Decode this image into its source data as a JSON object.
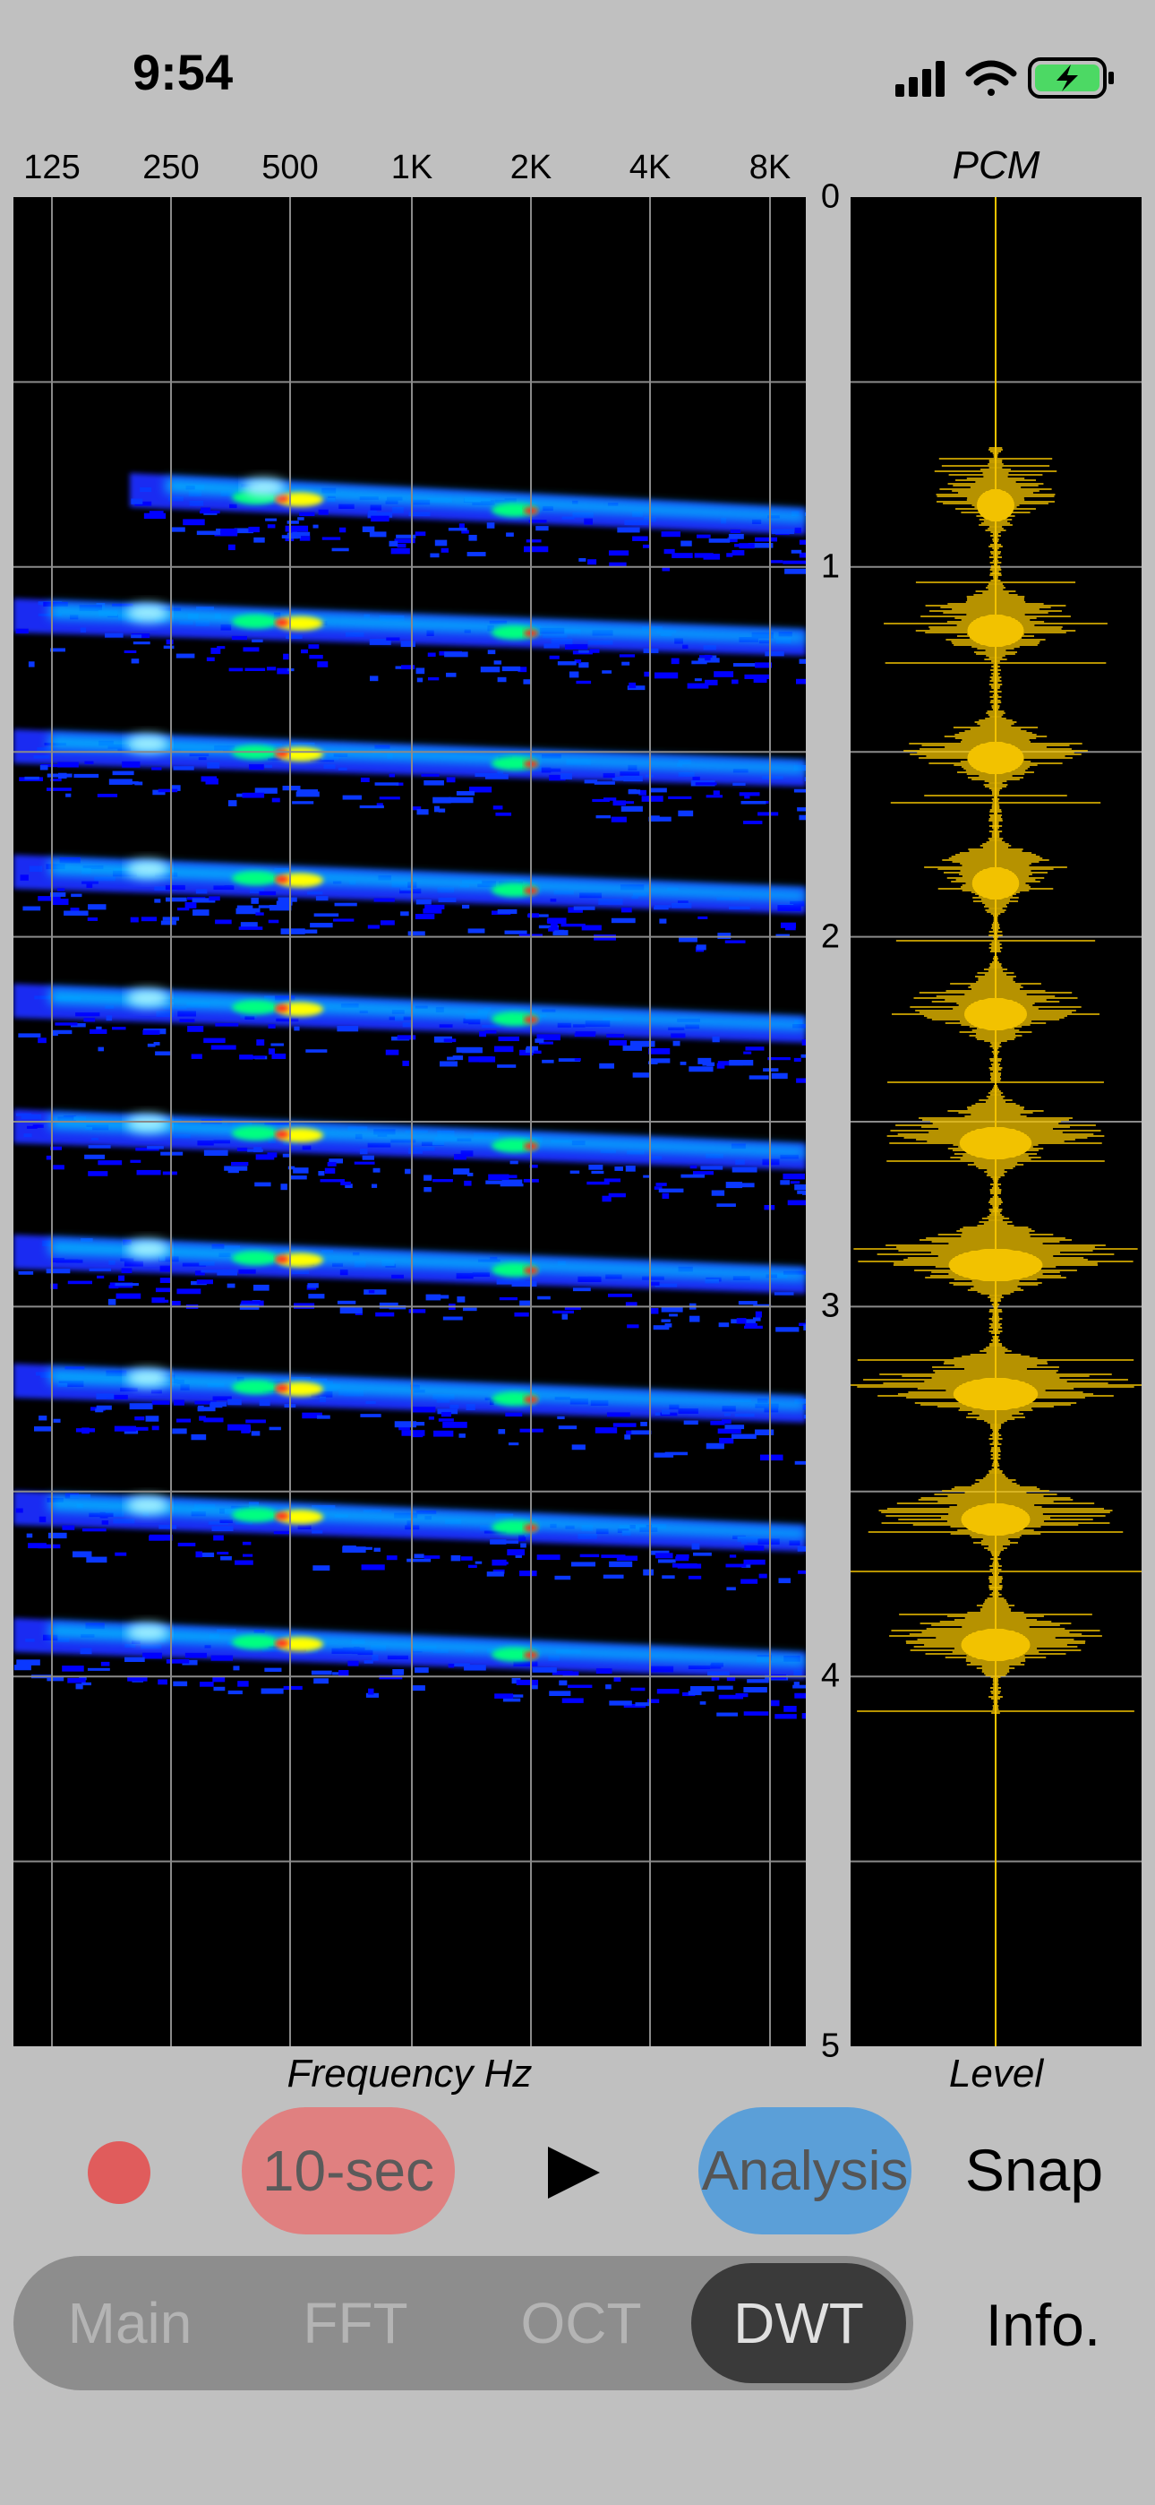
{
  "status_bar": {
    "time": "9:54",
    "icons": [
      "cellular-signal-icon",
      "wifi-icon",
      "battery-charging-icon"
    ],
    "battery_color": "#4cd964"
  },
  "spectrogram": {
    "frequency_ticks": [
      "125",
      "250",
      "500",
      "1K",
      "2K",
      "4K",
      "8K"
    ],
    "x_axis_title": "Frequency Hz",
    "time_ticks": [
      "0",
      "1",
      "2",
      "3",
      "4",
      "5"
    ],
    "background": "#000000",
    "gridline_color": "#888888",
    "colormap": [
      "#0000ff",
      "#00c8ff",
      "#00ff80",
      "#ffff00",
      "#ff0000"
    ]
  },
  "pcm": {
    "title": "PCM",
    "x_axis_title": "Level",
    "waveform_color": "#f2c200"
  },
  "controls": {
    "record_color": "#e05c5c",
    "duration_label": "10-sec",
    "duration_color": "#e08080",
    "play_icon": "play-icon",
    "analysis_label": "Analysis",
    "analysis_color": "#5b9fd8",
    "snap_label": "Snap"
  },
  "mode_tabs": {
    "items": [
      "Main",
      "FFT",
      "OCT",
      "DWT"
    ],
    "selected": "DWT"
  },
  "info_label": "Info."
}
